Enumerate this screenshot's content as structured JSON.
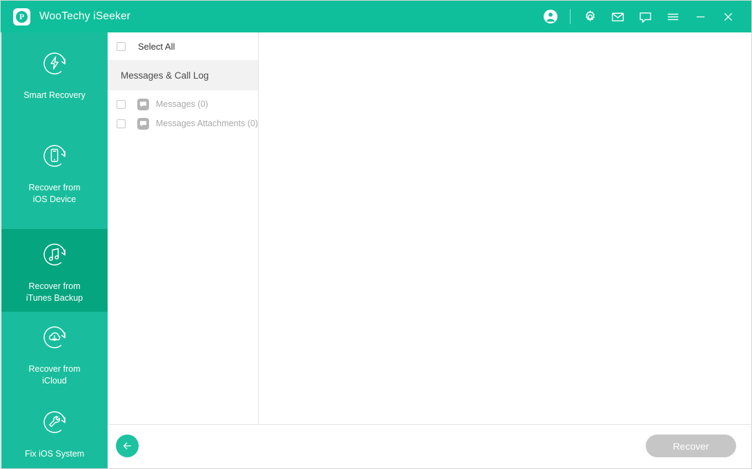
{
  "titlebar": {
    "app_title": "WooTechy iSeeker",
    "logo_letter": "P",
    "icons": [
      {
        "name": "account-icon",
        "label": "Account"
      },
      {
        "name": "settings-gear-icon",
        "label": "Settings"
      },
      {
        "name": "mail-icon",
        "label": "Feedback Mail"
      },
      {
        "name": "chat-bubble-icon",
        "label": "Support Chat"
      },
      {
        "name": "menu-hamburger-icon",
        "label": "Menu"
      },
      {
        "name": "minimize-icon",
        "label": "Minimize"
      },
      {
        "name": "close-icon",
        "label": "Close"
      }
    ]
  },
  "sidebar": {
    "items": [
      {
        "label": "Smart Recovery",
        "icon": "bolt-refresh-icon",
        "active": false
      },
      {
        "label": "Recover from\niOS Device",
        "icon": "phone-refresh-icon",
        "active": false
      },
      {
        "label": "Recover from\niTunes Backup",
        "icon": "music-refresh-icon",
        "active": true
      },
      {
        "label": "Recover from\niCloud",
        "icon": "cloud-download-refresh-icon",
        "active": false
      },
      {
        "label": "Fix iOS System",
        "icon": "wrench-refresh-icon",
        "active": false
      }
    ]
  },
  "list_panel": {
    "select_all_label": "Select All",
    "select_all_checked": false,
    "group_header": "Messages & Call Log",
    "rows": [
      {
        "label": "Messages (0)",
        "icon": "message-bubble-icon",
        "checked": false,
        "disabled": true
      },
      {
        "label": "Messages Attachments (0)",
        "icon": "message-bubble-icon",
        "checked": false,
        "disabled": true
      }
    ]
  },
  "bottom_bar": {
    "back_label": "Back",
    "recover_label": "Recover",
    "recover_disabled": true
  },
  "colors": {
    "header_teal": "#0fbf9b",
    "sidebar_teal": "#19bd9d",
    "sidebar_active_teal": "#05a580",
    "back_button_teal": "#1ec2a0",
    "disabled_gray": "#c6c6c6",
    "group_band_gray": "#f2f2f2"
  }
}
